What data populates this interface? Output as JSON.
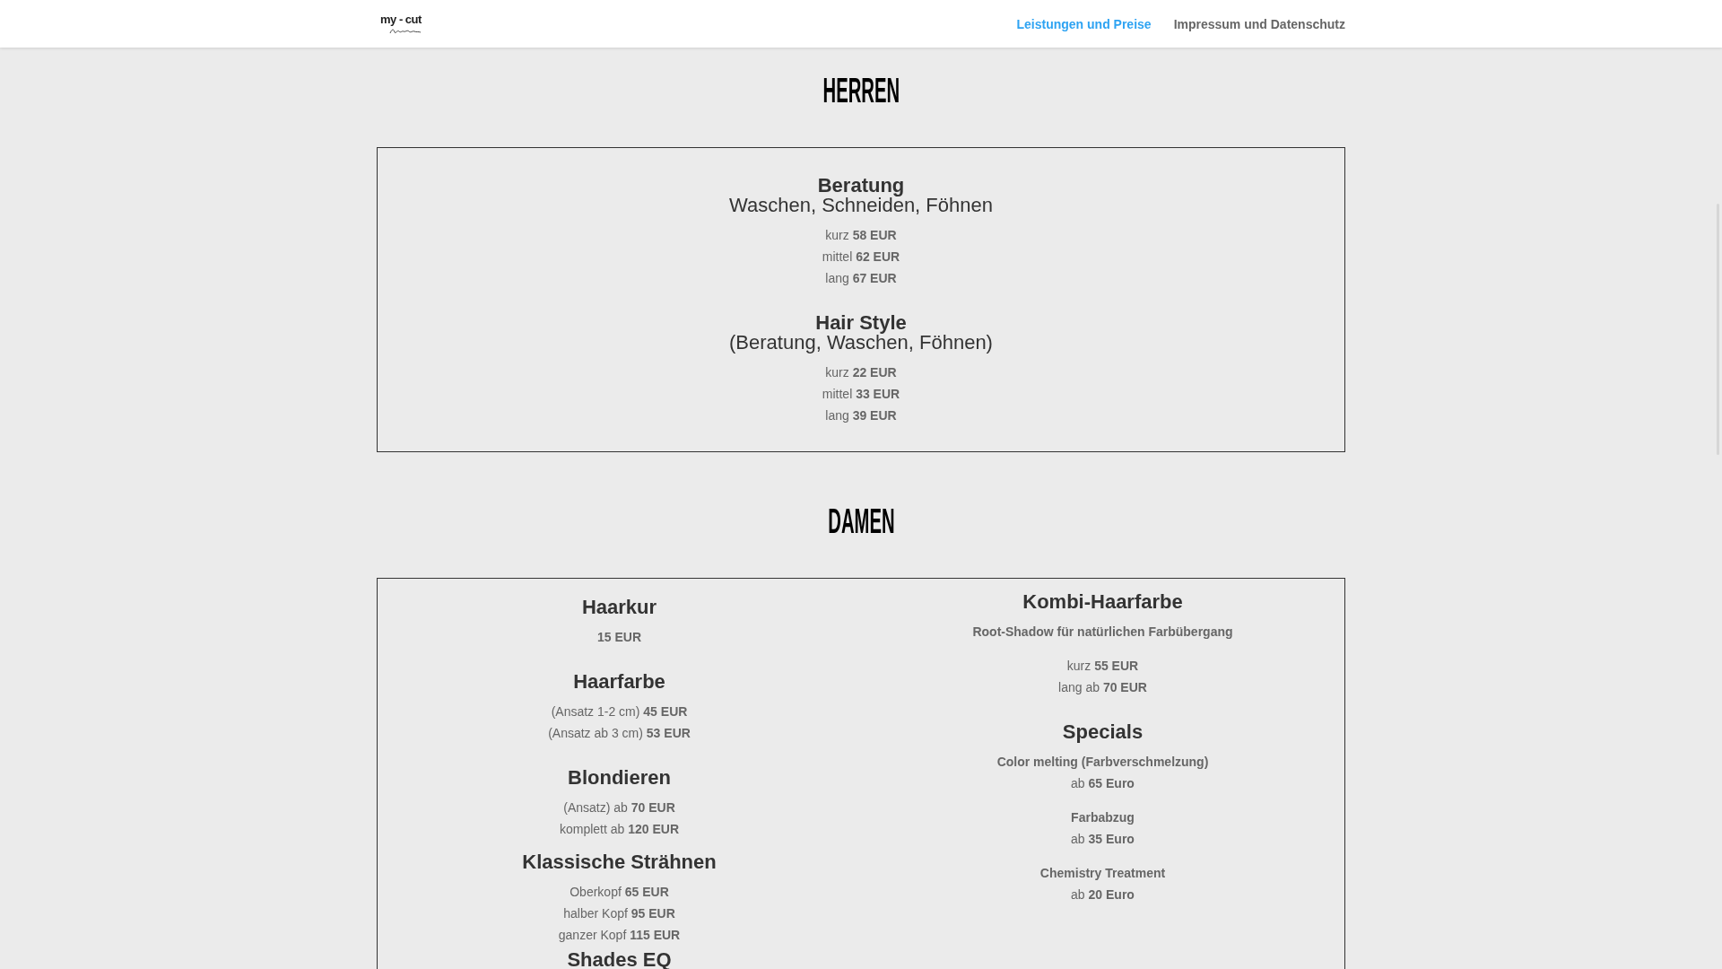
{
  "header": {
    "logo": {
      "text": "my - cut"
    },
    "nav": [
      {
        "label": "Leistungen und Preise",
        "selected": true
      },
      {
        "label": "Impressum und Datenschutz",
        "selected": false
      }
    ]
  },
  "sections": [
    {
      "title": "HERREN",
      "columns": [
        {
          "groups": [
            [
              {
                "title": "Beratung",
                "subtitle": "Waschen, Schneiden, Föhnen",
                "paragraphs": [
                  [
                    {
                      "kind": "text",
                      "text": "kurz **58 EUR**"
                    },
                    {
                      "kind": "text",
                      "text": "mittel **62 EUR**"
                    },
                    {
                      "kind": "text",
                      "text": "lang **67 EUR**"
                    }
                  ]
                ]
              }
            ],
            [
              {
                "title": "Hair Style",
                "subtitle": "(Beratung, Waschen, Föhnen)",
                "paragraphs": [
                  [
                    {
                      "kind": "text",
                      "text": "kurz **22 EUR**"
                    },
                    {
                      "kind": "text",
                      "text": "mittel **33 EUR**"
                    },
                    {
                      "kind": "text",
                      "text": "lang **39 EUR**"
                    }
                  ]
                ]
              }
            ]
          ]
        }
      ]
    },
    {
      "title": "DAMEN",
      "columns": [
        {
          "groups": [
            [
              {
                "title": "Haarkur",
                "paragraphs": [
                  [
                    {
                      "kind": "emphasis",
                      "text": "15 EUR"
                    }
                  ]
                ]
              }
            ],
            [
              {
                "title": "Haarfarbe",
                "paragraphs": [
                  [
                    {
                      "kind": "text",
                      "text": "(Ansatz 1-2 cm) **45 EUR**"
                    },
                    {
                      "kind": "text",
                      "text": "(Ansatz ab 3 cm) **53 EUR**"
                    }
                  ]
                ]
              }
            ],
            [
              {
                "title": "Blondieren",
                "paragraphs": [
                  [
                    {
                      "kind": "text",
                      "text": "(Ansatz) ab **70 EUR**"
                    },
                    {
                      "kind": "text",
                      "text": "komplett ab **120 EUR**"
                    }
                  ]
                ]
              },
              {
                "title": "Klassische Strähnen",
                "paragraphs": [
                  [
                    {
                      "kind": "text",
                      "text": "Oberkopf **65 EUR**"
                    },
                    {
                      "kind": "text",
                      "text": "halber Kopf **95 EUR**"
                    },
                    {
                      "kind": "text",
                      "text": "ganzer Kopf **115 EUR**"
                    }
                  ]
                ]
              },
              {
                "title": "Shades EQ"
              }
            ]
          ]
        },
        {
          "groups": [
            [
              {
                "title": "Kombi-Haarfarbe",
                "paragraphs": [
                  [
                    {
                      "kind": "emphasis",
                      "text": "Root-Shadow für natürlichen Farbübergang"
                    }
                  ],
                  [
                    {
                      "kind": "text",
                      "text": "kurz **55 EUR**"
                    },
                    {
                      "kind": "text",
                      "text": "lang ab **70 EUR**"
                    }
                  ]
                ]
              }
            ],
            [
              {
                "title": "Specials",
                "paragraphs": [
                  [
                    {
                      "kind": "emphasis",
                      "text": "Color melting (Farbverschmelzung)"
                    },
                    {
                      "kind": "text",
                      "text": "ab **65 Euro**"
                    }
                  ],
                  [
                    {
                      "kind": "emphasis",
                      "text": "Farbabzug"
                    },
                    {
                      "kind": "text",
                      "text": "ab **35 Euro**"
                    }
                  ],
                  [
                    {
                      "kind": "emphasis",
                      "text": "Chemistry Treatment"
                    },
                    {
                      "kind": "text",
                      "text": "ab **20 Euro**"
                    }
                  ]
                ]
              }
            ]
          ]
        }
      ]
    }
  ]
}
